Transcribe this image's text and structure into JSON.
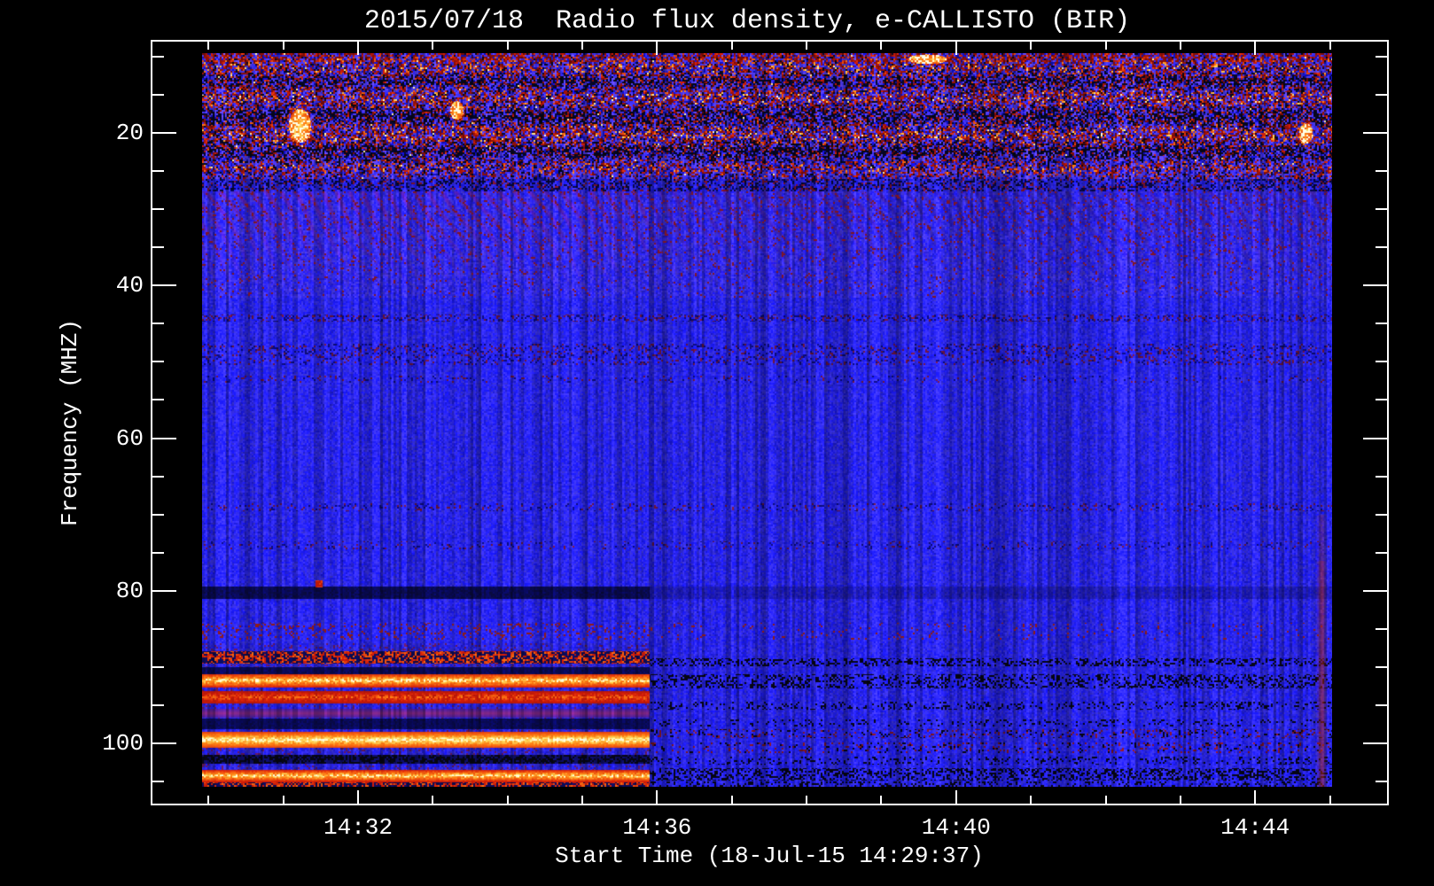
{
  "page": {
    "background": "#000000",
    "text_color": "#ffffff"
  },
  "chart_data": {
    "type": "heatmap",
    "subtype": "solar radio spectrogram",
    "title": "2015/07/18  Radio flux density, e-CALLISTO (BIR)",
    "xlabel": "Start Time (18-Jul-15 14:29:37)",
    "ylabel": "Frequency (MHZ)",
    "grid": false,
    "legend": "none",
    "y_axis": {
      "unit": "MHz",
      "min": 7.8,
      "max": 108,
      "inverted": true,
      "major_ticks": [
        20,
        40,
        60,
        80,
        100
      ],
      "tick_labels": [
        "20",
        "40",
        "60",
        "80",
        "100"
      ],
      "minor_tick_step_mhz": 5,
      "minor_range": [
        10,
        105
      ]
    },
    "x_axis": {
      "unit": "time (UT)",
      "start_label_time": "14:29:37",
      "data_start": "~14:29:55",
      "data_end": "~14:45:02",
      "major_ticks": [
        {
          "minute": 32,
          "label": "14:32"
        },
        {
          "minute": 36,
          "label": "14:36"
        },
        {
          "minute": 40,
          "label": "14:40"
        },
        {
          "minute": 44,
          "label": "14:44"
        }
      ],
      "minor_tick_step": "1 min",
      "minor_range_minutes": [
        30,
        45
      ]
    },
    "colormap": {
      "name": "e-CALLISTO blue-hot",
      "background_blue": "#2020dd",
      "dropout_black": "#000010",
      "medium_red": "#cc2200",
      "strong_orange": "#ff8820",
      "max_yellow": "#ffee88"
    },
    "rfi_top_band": {
      "freq_mhz": [
        9.5,
        26
      ],
      "time": "entire interval",
      "appearance": "dense red/orange bursts with black dropouts on blue"
    },
    "ripples": {
      "freq_mhz": [
        27.6,
        41.5
      ],
      "time": "entire interval",
      "appearance": "slanted purple/dark diagonal interference striations, weaker 14:38-14:41"
    },
    "quiet_lines": [
      {
        "mhz": 44.2,
        "hw": 0.5,
        "p": 0.3
      },
      {
        "mhz": 48.3,
        "hw": 0.7,
        "p": 0.22
      },
      {
        "mhz": 49.7,
        "hw": 0.7,
        "p": 0.2
      },
      {
        "mhz": 52.2,
        "hw": 0.5,
        "p": 0.1
      },
      {
        "mhz": 69.0,
        "hw": 0.5,
        "p": 0.15
      },
      {
        "mhz": 74.0,
        "hw": 0.5,
        "p": 0.12
      }
    ],
    "absorption_line": {
      "freq_mhz": 80.2,
      "half_width_mhz": 0.85,
      "until": "~14:36",
      "appearance": "dark horizontal line"
    },
    "point_burst": {
      "freq_mhz": [
        78.1,
        79.5
      ],
      "minute": 31.45,
      "time": "~14:31:30",
      "appearance": "isolated red point"
    },
    "fm_cutoff_minute": 35.9,
    "fm_stations": {
      "time": "start to ~14:36",
      "stripes": [
        {
          "mhz": 88.7,
          "hw": 0.8,
          "kind": "speckle"
        },
        {
          "mhz": 90.4,
          "hw": 0.45,
          "kind": "dark"
        },
        {
          "mhz": 91.7,
          "hw": 0.95,
          "kind": "strong"
        },
        {
          "mhz": 93.9,
          "hw": 0.8,
          "kind": "med"
        },
        {
          "mhz": 96.0,
          "hw": 0.55,
          "kind": "faint"
        },
        {
          "mhz": 97.4,
          "hw": 0.7,
          "kind": "dark"
        },
        {
          "mhz": 99.5,
          "hw": 1.05,
          "kind": "vstrong"
        },
        {
          "mhz": 102.0,
          "hw": 0.6,
          "kind": "dspk"
        },
        {
          "mhz": 104.2,
          "hw": 0.8,
          "kind": "strong"
        },
        {
          "mhz": 105.5,
          "hw": 0.7,
          "kind": "speckle"
        }
      ]
    },
    "post_cutoff_rows": [
      {
        "mhz": 89.3,
        "hw": 0.5,
        "p": 0.35
      },
      {
        "mhz": 91.8,
        "hw": 0.95,
        "p": 0.3
      },
      {
        "mhz": 95.0,
        "hw": 0.5,
        "p": 0.18
      },
      {
        "mhz": 97.3,
        "hw": 0.45,
        "p": 0.14
      },
      {
        "mhz": 98.7,
        "hw": 0.6,
        "p": 0.2
      },
      {
        "mhz": 100.5,
        "hw": 0.7,
        "p": 0.18
      },
      {
        "mhz": 102.2,
        "hw": 0.5,
        "p": 0.16
      },
      {
        "mhz": 104.0,
        "hw": 0.85,
        "p": 0.38
      },
      {
        "mhz": 105.5,
        "hw": 0.6,
        "p": 0.25
      }
    ],
    "edge_streak": {
      "minute": 44.89,
      "time": "~14:44:53",
      "freq_mhz": [
        70,
        106
      ],
      "appearance": "faint red vertical streak at right edge of data"
    },
    "features": [
      "Broadband RFI 9.5-26 MHz across whole interval (red/black speckle)",
      "Diagonal ripple interference 27-41 MHz, fading 14:38-14:41",
      "Faint horizontal RFI lines near 44, 48, 50, 69, 74 MHz",
      "Dark absorption line at 80 MHz until ~14:36",
      "Single red point burst near 79 MHz at ~14:31:30",
      "Bright FM broadcast stripes 87-106 MHz until ~14:36, brightest at 99.5 and 104 MHz",
      "After ~14:36 FM rows become dark dashed lines",
      "Faint red vertical streak near 14:44:53 below 70 MHz data edge"
    ]
  }
}
